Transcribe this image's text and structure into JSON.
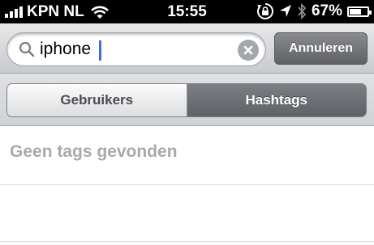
{
  "status_bar": {
    "carrier": "KPN NL",
    "time": "15:55",
    "battery_percent": "67%",
    "battery_level": 0.67,
    "icons": [
      "signal-icon",
      "wifi-icon",
      "rotation-lock-icon",
      "location-icon",
      "bluetooth-icon",
      "battery-icon"
    ]
  },
  "search": {
    "value": "iphone",
    "cancel_label": "Annuleren"
  },
  "segments": {
    "items": [
      {
        "label": "Gebruikers",
        "selected": false
      },
      {
        "label": "Hashtags",
        "selected": true
      }
    ]
  },
  "results": {
    "empty_message": "Geen tags gevonden"
  },
  "colors": {
    "caret": "#3b6fd8",
    "selected_segment": "#6b6e73",
    "empty_text": "#a9a9a9"
  }
}
